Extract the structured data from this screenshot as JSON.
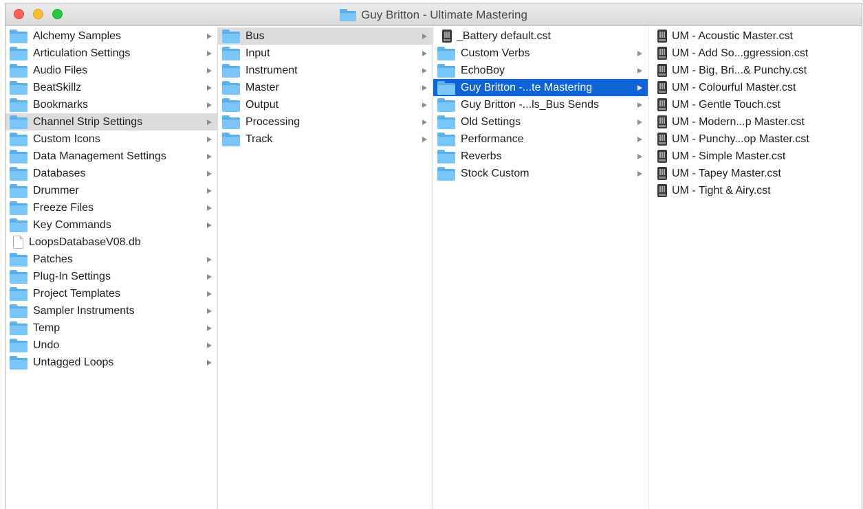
{
  "window": {
    "title": "Guy Britton - Ultimate Mastering"
  },
  "columns": [
    {
      "items": [
        {
          "label": "Alchemy Samples",
          "type": "folder",
          "arrow": true
        },
        {
          "label": "Articulation Settings",
          "type": "folder",
          "arrow": true
        },
        {
          "label": "Audio Files",
          "type": "folder",
          "arrow": true
        },
        {
          "label": "BeatSkillz",
          "type": "folder",
          "arrow": true
        },
        {
          "label": "Bookmarks",
          "type": "folder",
          "arrow": true
        },
        {
          "label": "Channel Strip Settings",
          "type": "folder",
          "arrow": true,
          "selected": "path"
        },
        {
          "label": "Custom Icons",
          "type": "folder",
          "arrow": true
        },
        {
          "label": "Data Management Settings",
          "type": "folder",
          "arrow": true
        },
        {
          "label": "Databases",
          "type": "folder",
          "arrow": true
        },
        {
          "label": "Drummer",
          "type": "folder",
          "arrow": true
        },
        {
          "label": "Freeze Files",
          "type": "folder",
          "arrow": true
        },
        {
          "label": "Key Commands",
          "type": "folder",
          "arrow": true
        },
        {
          "label": "LoopsDatabaseV08.db",
          "type": "file",
          "arrow": false
        },
        {
          "label": "Patches",
          "type": "folder",
          "arrow": true
        },
        {
          "label": "Plug-In Settings",
          "type": "folder",
          "arrow": true
        },
        {
          "label": "Project Templates",
          "type": "folder",
          "arrow": true
        },
        {
          "label": "Sampler Instruments",
          "type": "folder",
          "arrow": true
        },
        {
          "label": "Temp",
          "type": "folder",
          "arrow": true
        },
        {
          "label": "Undo",
          "type": "folder",
          "arrow": true
        },
        {
          "label": "Untagged Loops",
          "type": "folder",
          "arrow": true
        }
      ]
    },
    {
      "items": [
        {
          "label": "Bus",
          "type": "folder",
          "arrow": true,
          "selected": "path"
        },
        {
          "label": "Input",
          "type": "folder",
          "arrow": true
        },
        {
          "label": "Instrument",
          "type": "folder",
          "arrow": true
        },
        {
          "label": "Master",
          "type": "folder",
          "arrow": true
        },
        {
          "label": "Output",
          "type": "folder",
          "arrow": true
        },
        {
          "label": "Processing",
          "type": "folder",
          "arrow": true
        },
        {
          "label": "Track",
          "type": "folder",
          "arrow": true
        }
      ]
    },
    {
      "items": [
        {
          "label": "_Battery default.cst",
          "type": "cst",
          "arrow": false
        },
        {
          "label": "Custom Verbs",
          "type": "folder",
          "arrow": true
        },
        {
          "label": "EchoBoy",
          "type": "folder",
          "arrow": true
        },
        {
          "label": "Guy Britton -...te Mastering",
          "type": "folder",
          "arrow": true,
          "selected": "active"
        },
        {
          "label": "Guy Britton -...ls_Bus Sends",
          "type": "folder",
          "arrow": true
        },
        {
          "label": "Old Settings",
          "type": "folder",
          "arrow": true
        },
        {
          "label": "Performance",
          "type": "folder",
          "arrow": true
        },
        {
          "label": "Reverbs",
          "type": "folder",
          "arrow": true
        },
        {
          "label": "Stock Custom",
          "type": "folder",
          "arrow": true
        }
      ]
    },
    {
      "items": [
        {
          "label": "UM - Acoustic Master.cst",
          "type": "cst",
          "arrow": false
        },
        {
          "label": "UM - Add So...ggression.cst",
          "type": "cst",
          "arrow": false
        },
        {
          "label": "UM - Big, Bri...& Punchy.cst",
          "type": "cst",
          "arrow": false
        },
        {
          "label": "UM - Colourful Master.cst",
          "type": "cst",
          "arrow": false
        },
        {
          "label": "UM - Gentle Touch.cst",
          "type": "cst",
          "arrow": false
        },
        {
          "label": "UM - Modern...p Master.cst",
          "type": "cst",
          "arrow": false
        },
        {
          "label": "UM - Punchy...op Master.cst",
          "type": "cst",
          "arrow": false
        },
        {
          "label": "UM - Simple Master.cst",
          "type": "cst",
          "arrow": false
        },
        {
          "label": "UM - Tapey Master.cst",
          "type": "cst",
          "arrow": false
        },
        {
          "label": "UM - Tight & Airy.cst",
          "type": "cst",
          "arrow": false
        }
      ]
    }
  ]
}
